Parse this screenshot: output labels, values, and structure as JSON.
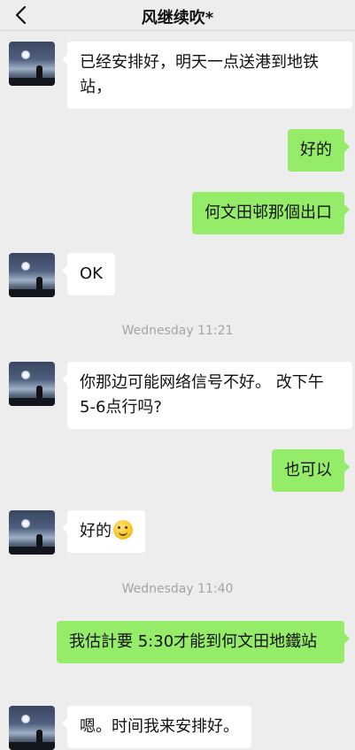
{
  "header": {
    "title": "风继续吹*",
    "back_icon": "chevron-left-icon"
  },
  "messages": [
    {
      "side": "in",
      "text": "已经安排好，明天一点送港到地铁站，"
    },
    {
      "side": "out",
      "text": "好的"
    },
    {
      "side": "out",
      "text": "何文田邨那個出口"
    },
    {
      "side": "in",
      "text": "OK"
    },
    {
      "timestamp": "Wednesday 11:21"
    },
    {
      "side": "in",
      "text": "你那边可能网络信号不好。 改下午 5-6点行吗?"
    },
    {
      "side": "out",
      "text": "也可以"
    },
    {
      "side": "in",
      "text": "好的",
      "emoji": "smiling-face-icon"
    },
    {
      "timestamp": "Wednesday 11:40"
    },
    {
      "side": "out",
      "text": "我估計要 5:30才能到何文田地鐵站"
    },
    {
      "side": "in",
      "text": "嗯。时间我来安排好。"
    }
  ],
  "colors": {
    "background": "#ededed",
    "incoming": "#ffffff",
    "outgoing": "#95ec69"
  }
}
